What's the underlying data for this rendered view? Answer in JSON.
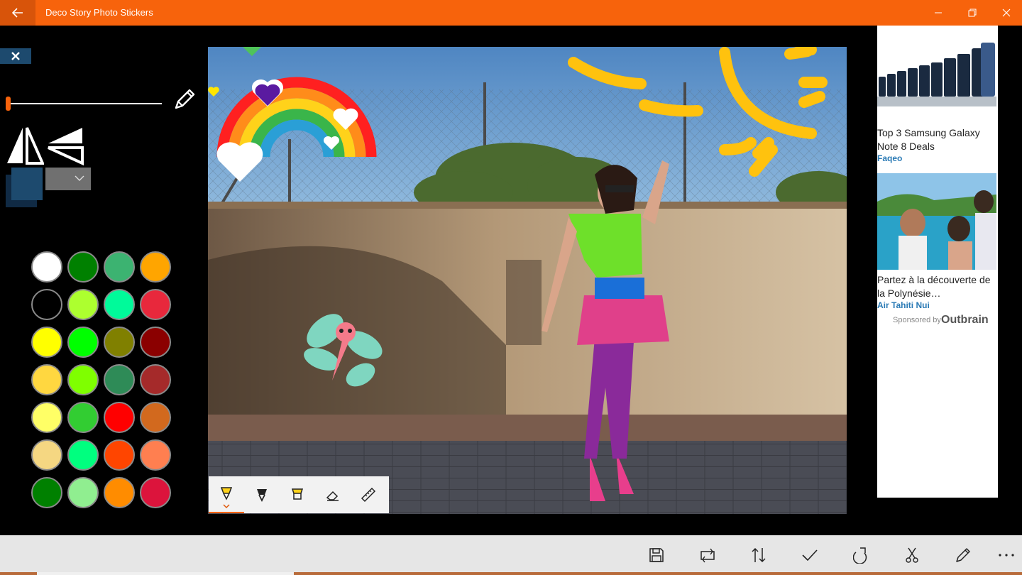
{
  "titlebar": {
    "title": "Deco Story Photo Stickers",
    "color": "#f7630c"
  },
  "icons": {
    "back": "back-arrow-icon",
    "minimize": "minimize-icon",
    "restore": "restore-icon",
    "close": "close-icon",
    "panel_close": "x-icon",
    "pencil": "pencil-icon",
    "flip_h": "flip-horizontal-icon",
    "flip_v": "flip-vertical-icon"
  },
  "tools": {
    "brush_size": 0.0
  },
  "palette": [
    [
      "#ffffff",
      "#008000",
      "#3cb371",
      "#ffa500"
    ],
    [
      "#000000",
      "#adff2f",
      "#00fa9a",
      "#e8283c"
    ],
    [
      "#ffff00",
      "#00ff00",
      "#808000",
      "#8b0000"
    ],
    [
      "#ffd740",
      "#7fff00",
      "#2e8b57",
      "#a52a2a"
    ],
    [
      "#ffff66",
      "#32cd32",
      "#ff0000",
      "#d2691e"
    ],
    [
      "#f5d782",
      "#00ff7f",
      "#ff4500",
      "#ff7f50"
    ],
    [
      "#008000",
      "#90ee90",
      "#ff8c00",
      "#dc143c"
    ]
  ],
  "selected_color": "#1d4a6e",
  "pen_tools": [
    "pen-icon",
    "marker-icon",
    "highlighter-icon",
    "eraser-icon",
    "ruler-icon"
  ],
  "ad": {
    "items": [
      {
        "title": "Top 3 Samsung Galaxy Note 8 Deals",
        "source": "Faqeo"
      },
      {
        "title": "Partez à la découverte de la Polynésie…",
        "source": "Air Tahiti Nui"
      }
    ],
    "sponsored_label": "Sponsored by",
    "brand": "Outbrain"
  },
  "commands": [
    "save-icon",
    "crop-rotate-icon",
    "swap-vertical-icon",
    "check-icon",
    "redo-icon",
    "cut-icon",
    "edit-icon",
    "more-icon"
  ]
}
